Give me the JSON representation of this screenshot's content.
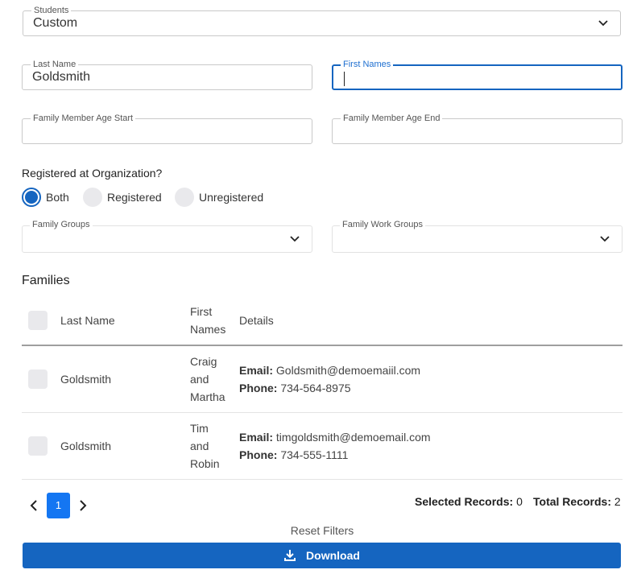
{
  "students": {
    "label": "Students",
    "value": "Custom"
  },
  "last_name": {
    "label": "Last Name",
    "value": "Goldsmith"
  },
  "first_names": {
    "label": "First Names",
    "value": ""
  },
  "age_start": {
    "label": "Family Member Age Start",
    "value": ""
  },
  "age_end": {
    "label": "Family Member Age End",
    "value": ""
  },
  "registered": {
    "question": "Registered at Organization?",
    "options": [
      "Both",
      "Registered",
      "Unregistered"
    ],
    "selected": "Both"
  },
  "family_groups": {
    "label": "Family Groups",
    "value": ""
  },
  "family_work_groups": {
    "label": "Family Work Groups",
    "value": ""
  },
  "families": {
    "title": "Families",
    "columns": {
      "last_name": "Last Name",
      "first_names_line1": "First",
      "first_names_line2": "Names",
      "details": "Details"
    },
    "rows": [
      {
        "last_name": "Goldsmith",
        "first_names": [
          "Craig",
          "and",
          "Martha"
        ],
        "email_label": "Email:",
        "email": "Goldsmith@demoemaiil.com",
        "phone_label": "Phone:",
        "phone": "734-564-8975"
      },
      {
        "last_name": "Goldsmith",
        "first_names": [
          "Tim",
          "and",
          "Robin"
        ],
        "email_label": "Email:",
        "email": "timgoldsmith@demoemail.com",
        "phone_label": "Phone:",
        "phone": "734-555-1111"
      }
    ]
  },
  "pagination": {
    "current_page": "1"
  },
  "stats": {
    "selected_label": "Selected Records:",
    "selected_value": "0",
    "total_label": "Total Records:",
    "total_value": "2"
  },
  "actions": {
    "reset": "Reset Filters",
    "download": "Download"
  },
  "colors": {
    "accent": "#1565c0",
    "page_button": "#1476f2"
  }
}
